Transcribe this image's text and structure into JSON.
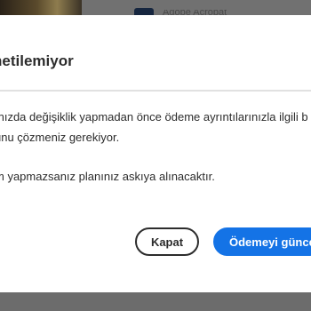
{
  "background": {
    "app_label": "Adobe Acrobat"
  },
  "dialog": {
    "title": "netilemiyor",
    "body_line_1": "ınızda değişiklik yapmadan önce ödeme ayrıntılarınızla ilgili b",
    "body_line_2": "unu çözmeniz gerekiyor.",
    "body_line_3": "m yapmazsanız planınız askıya alınacaktır."
  },
  "buttons": {
    "close_label": "Kapat",
    "update_label": "Ödemeyi güncelle"
  },
  "colors": {
    "overlay": "#6c6c6c",
    "dialog_bg": "#ffffff",
    "text": "#2c2c2c",
    "primary": "#1473e6"
  }
}
